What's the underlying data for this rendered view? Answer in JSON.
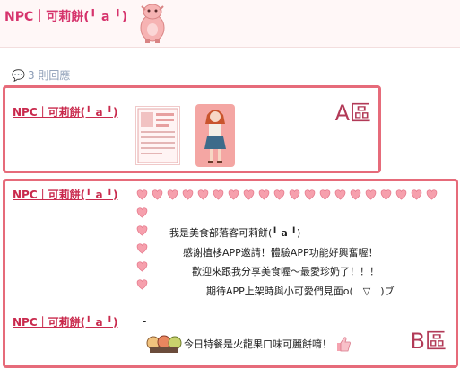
{
  "header": {
    "title": "NPC｜可莉餅(╹ 𝗮 ╹)",
    "mascot_icon": "pink-mascot-icon"
  },
  "replies": {
    "icon": "speech-bubble-icon",
    "text": "3 則回應"
  },
  "zone_a": {
    "label": "A區",
    "author": "NPC｜可莉餅(╹ 𝗮 ╹)"
  },
  "zone_b": {
    "label": "B區",
    "author_top": "NPC｜可莉餅(╹ 𝗮 ╹)",
    "author_bottom": "NPC｜可莉餅(╹ 𝗮 ╹)",
    "dash": "-",
    "messages": [
      "我是美食部落客可莉餅(╹ 𝗮 ╹)",
      "感謝植栘APP邀請！體驗APP功能好興奮喔！",
      "歡迎來跟我分享美食喔～最愛珍奶了！！！",
      "期待APP上架時與小可愛們見面o(￣▽￣)ブ"
    ],
    "special_note": "今日特餐是火龍果口味可麗餅唷！",
    "heart_icon": "pink-heart-icon",
    "thumbs_icon": "thumbs-up-icon"
  },
  "colors": {
    "accent": "#d6336c",
    "zone_border": "#e66b7a",
    "heart": "#f6a0ad"
  }
}
